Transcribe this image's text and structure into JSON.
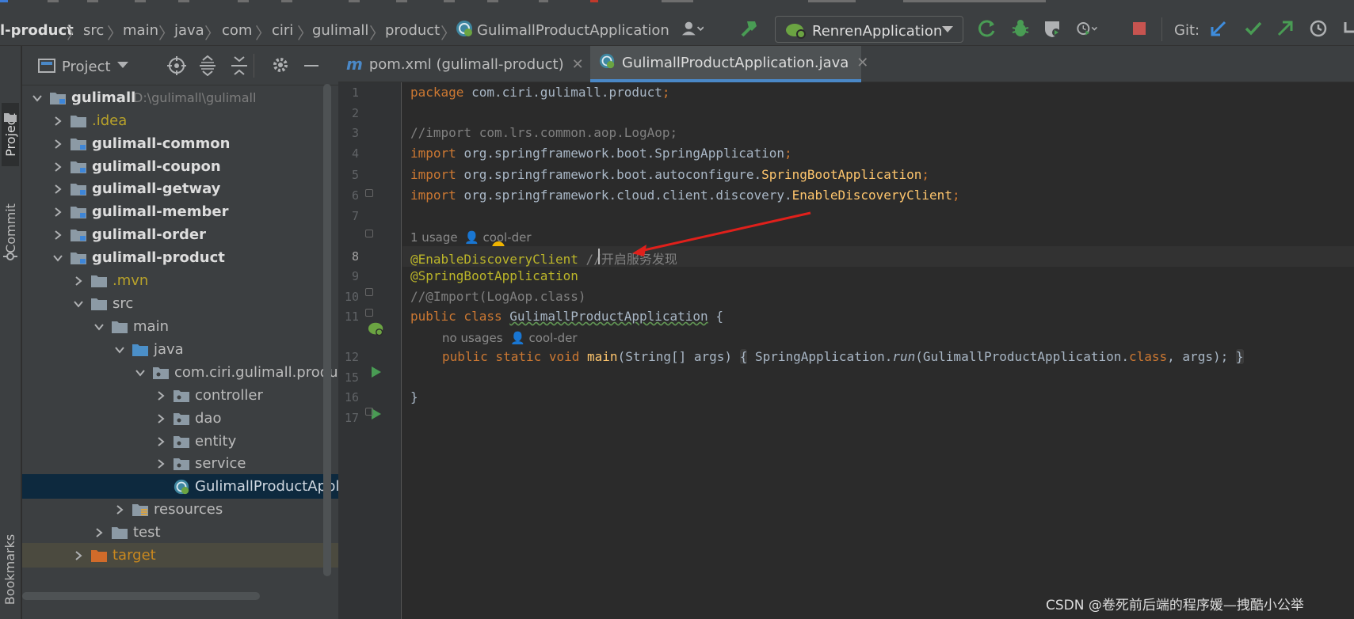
{
  "breadcrumbs": [
    "l-product",
    "src",
    "main",
    "java",
    "com",
    "ciri",
    "gulimall",
    "product",
    "GulimallProductApplication"
  ],
  "run_config": {
    "label": "RenrenApplication"
  },
  "git_label": "Git:",
  "stripe": {
    "project": "Project",
    "commit": "Commit",
    "bookmarks": "Bookmarks"
  },
  "project_panel": {
    "title": "Project",
    "tree": [
      {
        "label": "gulimall",
        "path": "D:\\gulimall\\gulimall",
        "expanded": true
      },
      {
        "label": ".idea"
      },
      {
        "label": "gulimall-common"
      },
      {
        "label": "gulimall-coupon"
      },
      {
        "label": "gulimall-getway"
      },
      {
        "label": "gulimall-member"
      },
      {
        "label": "gulimall-order"
      },
      {
        "label": "gulimall-product",
        "expanded": true
      },
      {
        "label": ".mvn"
      },
      {
        "label": "src",
        "expanded": true
      },
      {
        "label": "main",
        "expanded": true
      },
      {
        "label": "java",
        "expanded": true
      },
      {
        "label": "com.ciri.gulimall.product",
        "expanded": true
      },
      {
        "label": "controller"
      },
      {
        "label": "dao"
      },
      {
        "label": "entity"
      },
      {
        "label": "service"
      },
      {
        "label": "GulimallProductApplication"
      },
      {
        "label": "resources"
      },
      {
        "label": "test"
      },
      {
        "label": "target"
      }
    ]
  },
  "tabs": [
    {
      "label": "pom.xml (gulimall-product)",
      "active": false
    },
    {
      "label": "GulimallProductApplication.java",
      "active": true
    }
  ],
  "editor": {
    "line_numbers": [
      "1",
      "2",
      "3",
      "4",
      "5",
      "6",
      "7",
      "8",
      "9",
      "10",
      "11",
      "12",
      "15",
      "16",
      "17"
    ],
    "lines": {
      "l1a": "package ",
      "l1b": "com.ciri.gulimall.product",
      "l1c": ";",
      "l3": "//import com.lrs.common.aop.LogAop;",
      "l4a": "import ",
      "l4b": "org.springframework.boot.SpringApplication",
      "l4c": ";",
      "l5a": "import ",
      "l5b": "org.springframework.boot.autoconfigure.",
      "l5m": "SpringBootApplication",
      "l5c": ";",
      "l6a": "import ",
      "l6b": "org.springframework.cloud.client.discovery.",
      "l6m": "EnableDiscoveryClient",
      "l6c": ";",
      "h1a": "1 usage",
      "h1b": "cool-der",
      "l8a": "@EnableDiscoveryClient",
      "l8b": " //开启服务发现",
      "l9": "@SpringBootApplication",
      "l10": "//@Import(LogAop.class)",
      "l11a": "public class ",
      "l11b": "GulimallProductApplication",
      "l11c": " {",
      "h2a": "no usages",
      "h2b": "cool-der",
      "l12a": "public static void ",
      "l12b": "main",
      "l12c": "(String[] args) ",
      "l12d": "{",
      "l12e": " SpringApplication.",
      "l12f": "run",
      "l12g": "(GulimallProductApplication.",
      "l12h": "class",
      "l12i": ", args); ",
      "l12j": "}",
      "l16": "}"
    }
  },
  "watermark": "CSDN @卷死前后端的程序媛—拽酷小公举",
  "colors": {
    "accent": "#4a88c7",
    "run_green": "#499c54",
    "stop_red": "#c75450",
    "arrow_red": "#e0201b"
  }
}
